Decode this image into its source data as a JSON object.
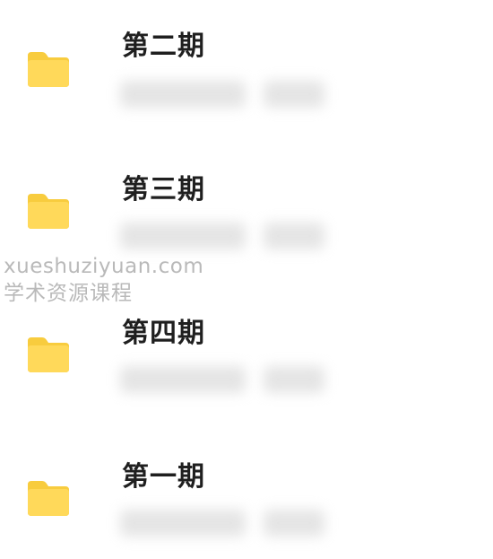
{
  "folders": [
    {
      "title": "第二期",
      "icon": "folder-icon"
    },
    {
      "title": "第三期",
      "icon": "folder-icon"
    },
    {
      "title": "第四期",
      "icon": "folder-icon"
    },
    {
      "title": "第一期",
      "icon": "folder-icon"
    }
  ],
  "watermark": {
    "domain": "xueshuziyuan.com",
    "label": "学术资源课程"
  },
  "colors": {
    "folder_fill": "#FFD95A",
    "folder_tab": "#F8CC3E",
    "title_text": "#1F1F1F",
    "watermark_text": "#B9B9B9"
  }
}
